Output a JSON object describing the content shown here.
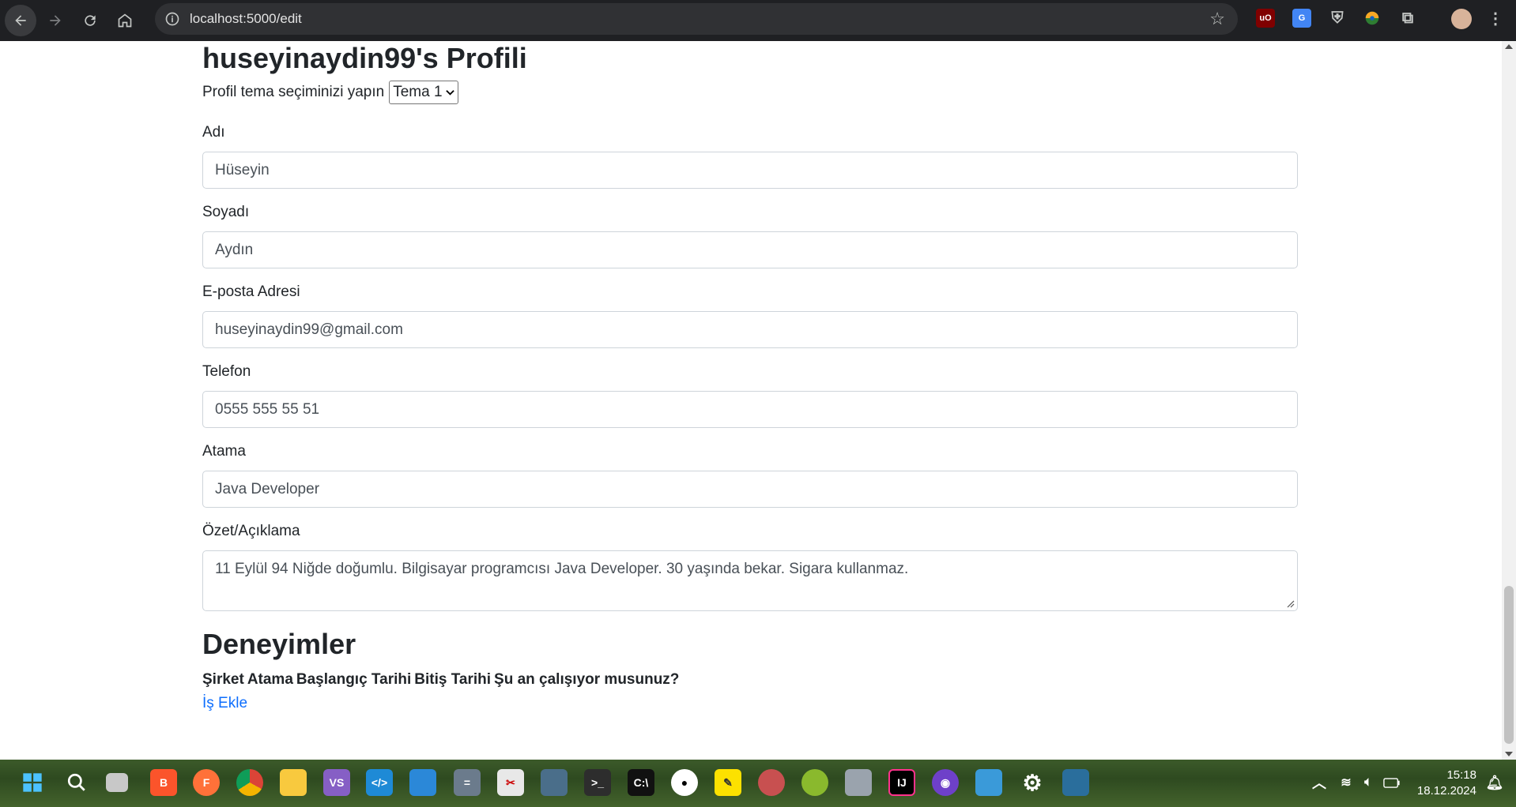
{
  "browser": {
    "url": "localhost:5000/edit",
    "extensions": [
      "ublock-icon",
      "translate-icon",
      "shield-icon",
      "colorful-extension-icon",
      "puzzle-icon"
    ]
  },
  "page": {
    "title": "huseyinaydin99's Profili",
    "theme_label": "Profil tema seçiminizi yapın",
    "theme_selected": "Tema 1",
    "fields": [
      {
        "label": "Adı",
        "value": "Hüseyin"
      },
      {
        "label": "Soyadı",
        "value": "Aydın"
      },
      {
        "label": "E-posta Adresi",
        "value": "huseyinaydin99@gmail.com"
      },
      {
        "label": "Telefon",
        "value": "0555 555 55 51"
      },
      {
        "label": "Atama",
        "value": "Java Developer"
      }
    ],
    "summary": {
      "label": "Özet/Açıklama",
      "value": "11 Eylül 94 Niğde doğumlu. Bilgisayar programcısı Java Developer. 30 yaşında bekar. Sigara kullanmaz."
    },
    "experiences": {
      "title": "Deneyimler",
      "columns": [
        "Şirket",
        "Atama",
        "Başlangıç Tarihi",
        "Bitiş Tarihi",
        "Şu an çalışıyor musunuz?"
      ],
      "add_link": "İş Ekle"
    }
  },
  "taskbar": {
    "time": "15:18",
    "date": "18.12.2024"
  },
  "colors": {
    "link": "#0d6efd",
    "chrome_bg": "#1f2023"
  }
}
